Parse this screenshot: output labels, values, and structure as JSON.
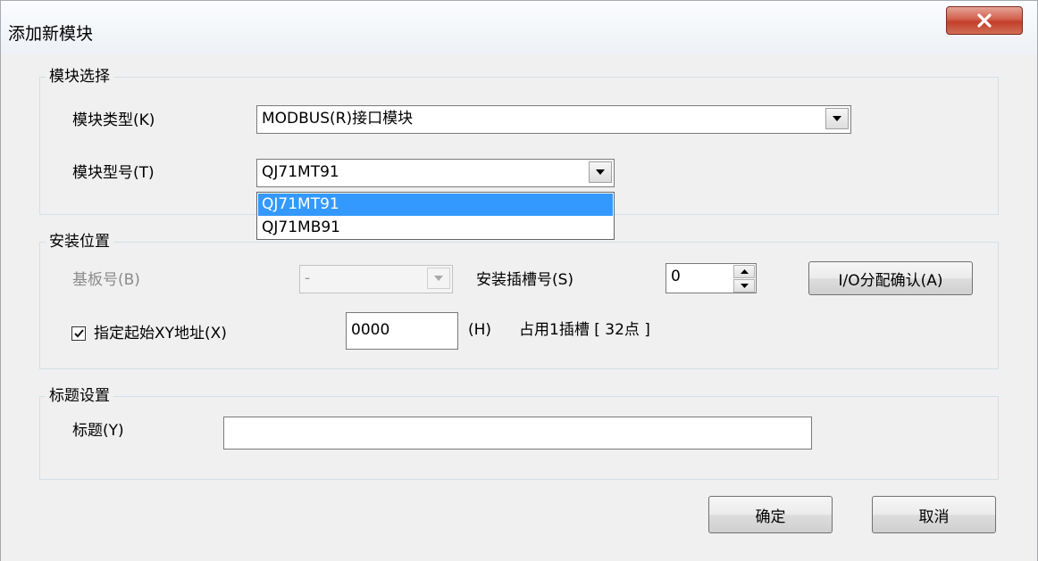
{
  "window": {
    "title": "添加新模块",
    "close_label": "X"
  },
  "module_select": {
    "legend": "模块选择",
    "type_label": "模块类型(K)",
    "type_value": "MODBUS(R)接口模块",
    "model_label": "模块型号(T)",
    "model_value": "QJ71MT91",
    "model_options": [
      "QJ71MT91",
      "QJ71MB91"
    ],
    "model_selected_index": 0
  },
  "mount_position": {
    "legend": "安装位置",
    "base_label": "基板号(B)",
    "base_value": "-",
    "slot_label": "安装插槽号(S)",
    "slot_value": "0",
    "io_button": "I/O分配确认(A)",
    "xy_checkbox_label": "指定起始XY地址(X)",
    "xy_checked": true,
    "xy_value": "0000",
    "xy_unit": "(H)",
    "occupy_text": "占用1插槽 [ 32点 ]"
  },
  "title_setting": {
    "legend": "标题设置",
    "title_label": "标题(Y)",
    "title_value": ""
  },
  "buttons": {
    "ok": "确定",
    "cancel": "取消"
  }
}
